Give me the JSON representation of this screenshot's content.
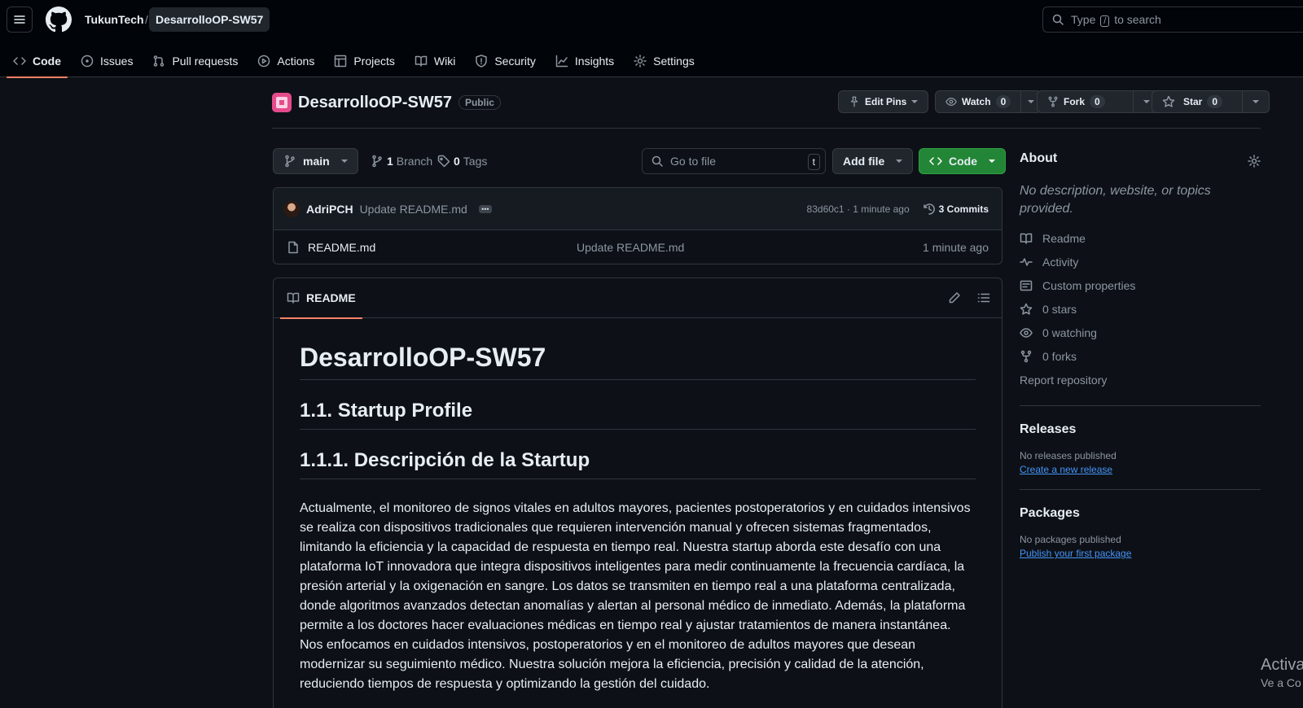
{
  "header": {
    "owner": "TukunTech",
    "separator": "/",
    "repo": "DesarrolloOP-SW57",
    "search": {
      "prefix": "Type",
      "key": "/",
      "suffix": "to search"
    }
  },
  "tabs": [
    {
      "label": "Code",
      "icon": "code-icon",
      "active": true
    },
    {
      "label": "Issues",
      "icon": "issue-icon"
    },
    {
      "label": "Pull requests",
      "icon": "pull-request-icon"
    },
    {
      "label": "Actions",
      "icon": "play-icon"
    },
    {
      "label": "Projects",
      "icon": "table-icon"
    },
    {
      "label": "Wiki",
      "icon": "book-icon"
    },
    {
      "label": "Security",
      "icon": "shield-icon"
    },
    {
      "label": "Insights",
      "icon": "graph-icon"
    },
    {
      "label": "Settings",
      "icon": "gear-icon"
    }
  ],
  "repo": {
    "name": "DesarrolloOP-SW57",
    "visibility": "Public",
    "edit_pins": "Edit Pins",
    "watch": {
      "label": "Watch",
      "count": "0"
    },
    "fork": {
      "label": "Fork",
      "count": "0"
    },
    "star": {
      "label": "Star",
      "count": "0"
    }
  },
  "filenav": {
    "branch": "main",
    "branches_count": "1",
    "branches_label": "Branch",
    "tags_count": "0",
    "tags_label": "Tags",
    "goto_placeholder": "Go to file",
    "goto_key": "t",
    "add_file": "Add file",
    "code": "Code"
  },
  "commit": {
    "author": "AdriPCH",
    "message": "Update README.md",
    "hash_time": "83d60c1 · 1 minute ago",
    "commits": "3 Commits"
  },
  "files": [
    {
      "name": "README.md",
      "message": "Update README.md",
      "time": "1 minute ago"
    }
  ],
  "readme": {
    "tab": "README",
    "h1": "DesarrolloOP-SW57",
    "h2a": "1.1. Startup Profile",
    "h2b": "1.1.1. Descripción de la Startup",
    "paragraph": "Actualmente, el monitoreo de signos vitales en adultos mayores, pacientes postoperatorios y en cuidados intensivos se realiza con dispositivos tradicionales que requieren intervención manual y ofrecen sistemas fragmentados, limitando la eficiencia y la capacidad de respuesta en tiempo real. Nuestra startup aborda este desafío con una plataforma IoT innovadora que integra dispositivos inteligentes para medir continuamente la frecuencia cardíaca, la presión arterial y la oxigenación en sangre. Los datos se transmiten en tiempo real a una plataforma centralizada, donde algoritmos avanzados detectan anomalías y alertan al personal médico de inmediato. Además, la plataforma permite a los doctores hacer evaluaciones médicas en tiempo real y ajustar tratamientos de manera instantánea. Nos enfocamos en cuidados intensivos, postoperatorios y en el monitoreo de adultos mayores que desean modernizar su seguimiento médico. Nuestra solución mejora la eficiencia, precisión y calidad de la atención, reduciendo tiempos de respuesta y optimizando la gestión del cuidado."
  },
  "sidebar": {
    "about_title": "About",
    "about_desc": "No description, website, or topics provided.",
    "items": [
      {
        "label": "Readme",
        "icon": "book-icon"
      },
      {
        "label": "Activity",
        "icon": "pulse-icon"
      },
      {
        "label": "Custom properties",
        "icon": "note-icon"
      },
      {
        "label": "0 stars",
        "icon": "star-icon"
      },
      {
        "label": "0 watching",
        "icon": "eye-icon"
      },
      {
        "label": "0 forks",
        "icon": "fork-icon"
      }
    ],
    "report": "Report repository",
    "releases_title": "Releases",
    "releases_none": "No releases published",
    "releases_link": "Create a new release",
    "packages_title": "Packages",
    "packages_none": "No packages published",
    "packages_link": "Publish your first package"
  },
  "watermark": {
    "line1": "Activa",
    "line2": "Ve a Co"
  },
  "colors": {
    "accent": "#f78166",
    "green": "#238636",
    "link": "#4493f8",
    "bg": "#0d1117",
    "header_bg": "#010409"
  }
}
